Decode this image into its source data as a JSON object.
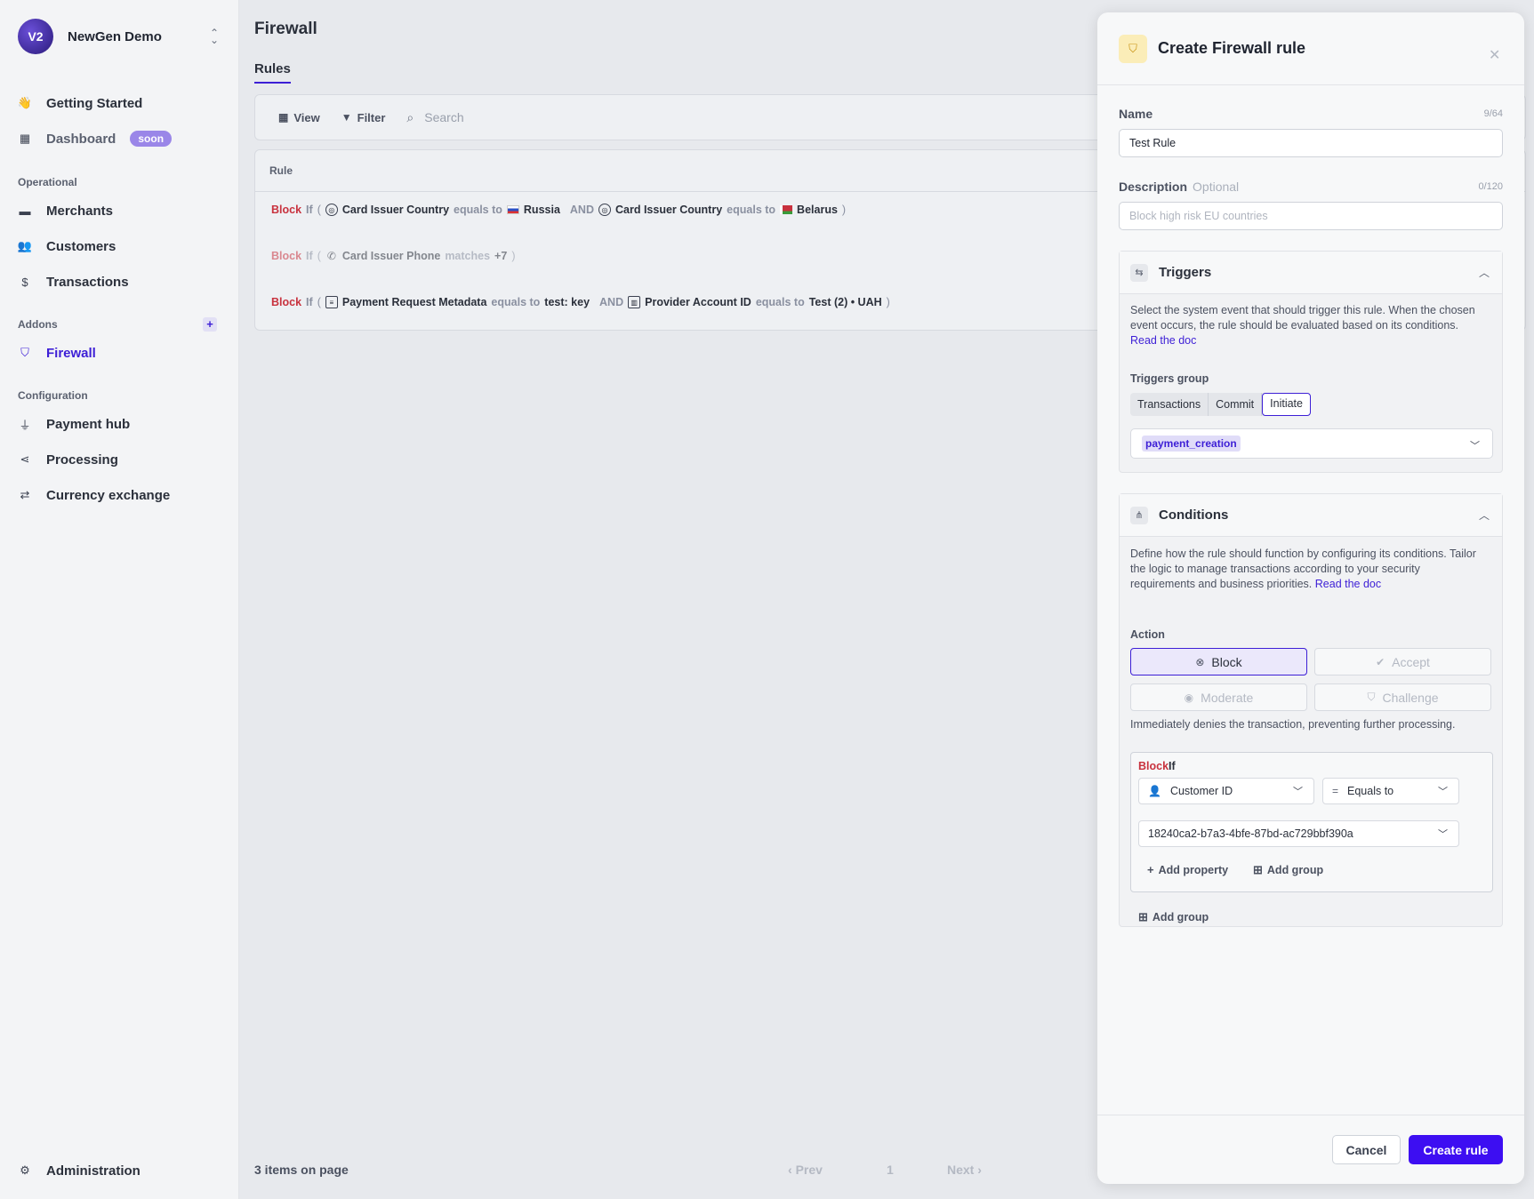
{
  "org": {
    "logo_text": "V2",
    "name": "NewGen Demo"
  },
  "sidebar": {
    "getting_started": "Getting Started",
    "dashboard": "Dashboard",
    "dashboard_badge": "soon",
    "operational_label": "Operational",
    "merchants": "Merchants",
    "customers": "Customers",
    "transactions": "Transactions",
    "addons_label": "Addons",
    "firewall": "Firewall",
    "configuration_label": "Configuration",
    "payment_hub": "Payment hub",
    "processing": "Processing",
    "currency_exchange": "Currency exchange",
    "administration": "Administration"
  },
  "main": {
    "title": "Firewall",
    "tab": "Rules",
    "toolbar": {
      "view": "View",
      "filter": "Filter",
      "search_placeholder": "Search"
    },
    "table_header": "Rule",
    "rules": [
      {
        "action": "Block",
        "if": "If",
        "open": "(",
        "c1_prop": "Card Issuer Country",
        "c1_op": "equals to",
        "c1_val": "Russia",
        "and": "AND",
        "c2_prop": "Card Issuer Country",
        "c2_op": "equals to",
        "c2_val": "Belarus",
        "close": ")"
      },
      {
        "action": "Block",
        "if": "If",
        "open": "(",
        "c1_prop": "Card Issuer Phone",
        "c1_op": "matches",
        "c1_val": "+7",
        "close": ")"
      },
      {
        "action": "Block",
        "if": "If",
        "open": "(",
        "c1_prop": "Payment Request Metadata",
        "c1_op": "equals to",
        "c1_val": "test: key",
        "and": "AND",
        "c2_prop": "Provider Account ID",
        "c2_op": "equals to",
        "c2_val": "Test (2) • UAH",
        "close": ")"
      }
    ],
    "items_on_page": "3 items on page",
    "pager": {
      "prev": "Prev",
      "page": "1",
      "next": "Next"
    }
  },
  "drawer": {
    "title": "Create Firewall rule",
    "name_label": "Name",
    "name_count": "9/64",
    "name_value": "Test Rule",
    "description_label": "Description",
    "description_optional": "Optional",
    "description_count": "0/120",
    "description_placeholder": "Block high risk EU countries",
    "triggers": {
      "title": "Triggers",
      "desc": "Select the system event that should trigger this rule. When the chosen event occurs, the rule should be evaluated based on its conditions.",
      "read_doc": "Read the doc",
      "group_label": "Triggers group",
      "segments": [
        "Transactions",
        "Commit",
        "Initiate"
      ],
      "event": "payment_creation"
    },
    "conditions": {
      "title": "Conditions",
      "desc": "Define how the rule should function by configuring its conditions. Tailor the logic to manage transactions according to your security requirements and business priorities.",
      "read_doc": "Read the doc",
      "action_label": "Action",
      "actions": {
        "block": "Block",
        "accept": "Accept",
        "moderate": "Moderate",
        "challenge": "Challenge"
      },
      "action_desc": "Immediately denies the transaction, preventing further processing.",
      "block_word": "Block",
      "if_word": "If",
      "property": "Customer ID",
      "operator": "Equals to",
      "value": "18240ca2-b7a3-4bfe-87bd-ac729bbf390a",
      "add_property": "Add property",
      "add_group_inner": "Add group",
      "add_group_outer": "Add group"
    },
    "cancel": "Cancel",
    "create": "Create rule"
  },
  "colors": {
    "accent": "#3d1fd6",
    "primary_button": "#3d0ef2",
    "block_red": "#c8323e"
  }
}
